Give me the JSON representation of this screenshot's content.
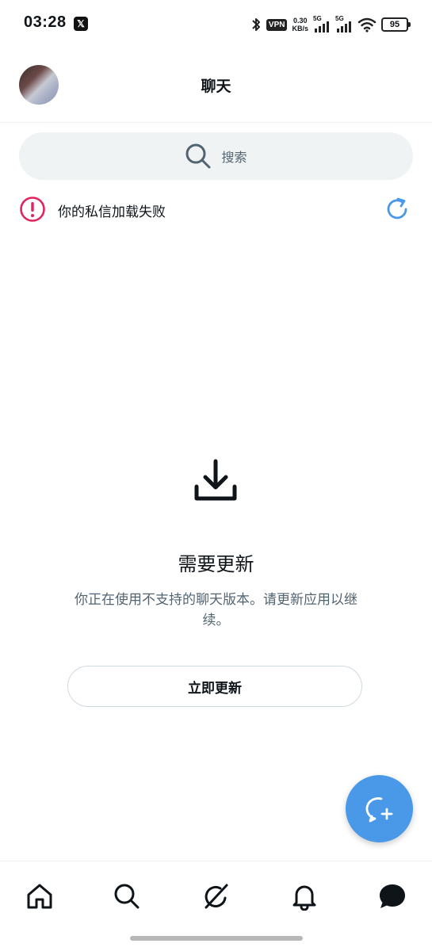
{
  "status_bar": {
    "time": "03:28",
    "app_badge": "𝕏",
    "vpn": "VPN",
    "speed_value": "0.30",
    "speed_unit": "KB/s",
    "sim1_label": "5G",
    "sim2_label": "5G",
    "battery": "95"
  },
  "header": {
    "title": "聊天"
  },
  "search": {
    "placeholder": "搜索"
  },
  "error": {
    "message": "你的私信加载失败",
    "color": "#e0245e"
  },
  "update": {
    "title": "需要更新",
    "description": "你正在使用不支持的聊天版本。请更新应用以继续。",
    "button_label": "立即更新"
  },
  "colors": {
    "accent": "#4a99e9",
    "error": "#e0245e",
    "text_primary": "#0f1419",
    "text_secondary": "#536471"
  },
  "nav": {
    "items": [
      "home-icon",
      "search-icon",
      "grok-icon",
      "bell-icon",
      "chat-icon"
    ]
  }
}
